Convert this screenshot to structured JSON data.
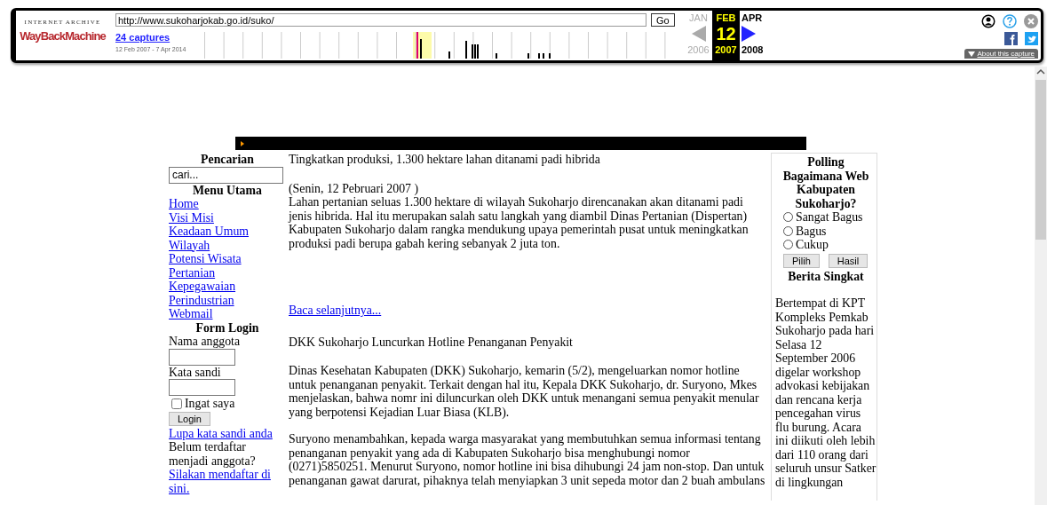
{
  "toolbar": {
    "logo_top": "INTERNET ARCHIVE",
    "logo_main": "WayBackMachine",
    "url": "http://www.sukoharjokab.go.id/suko/",
    "go": "Go",
    "captures": "24 captures",
    "range": "12 Feb 2007 - 7 Apr 2014",
    "calendar": [
      {
        "month": "JAN",
        "year": "2006",
        "disabled": true,
        "selected": false
      },
      {
        "month": "FEB",
        "day": "12",
        "year": "2007",
        "disabled": false,
        "selected": true
      },
      {
        "month": "APR",
        "year": "2008",
        "disabled": false,
        "selected": false
      }
    ],
    "about": "About this capture"
  },
  "sidebar": {
    "search_title": "Pencarian",
    "search_value": "cari...",
    "menu_title": "Menu Utama",
    "menu": [
      "Home",
      "Visi Misi",
      "Keadaan Umum",
      "Wilayah",
      "Potensi Wisata",
      "Pertanian",
      "Kepegawaian",
      "Perindustrian",
      "Webmail"
    ],
    "login_title": "Form Login",
    "username_label": "Nama anggota",
    "password_label": "Kata sandi",
    "remember": {
      "label": "Ingat saya",
      "checked": false
    },
    "login_button": "Login",
    "forgot": "Lupa kata sandi anda",
    "register_text": "Belum terdaftar menjadi anggota?",
    "register_link": "Silakan mendaftar di sini."
  },
  "articles": [
    {
      "title": "Tingkatkan produksi, 1.300 hektare lahan ditanami padi hibrida",
      "date": "(Senin, 12 Pebruari 2007 )",
      "paragraphs": [
        "Lahan pertanian seluas 1.300 hektare di wilayah Sukoharjo direncanakan akan ditanami padi jenis hibrida. Hal itu merupakan salah satu langkah yang diambil Dinas Pertanian (Dispertan) Kabupaten Sukoharjo dalam rangka mendukung upaya pemerintah pusat untuk meningkatkan produksi padi berupa gabah kering sebanyak 2 juta ton."
      ],
      "more": "Baca selanjutnya..."
    },
    {
      "title": "DKK Sukoharjo Luncurkan Hotline Penanganan Penyakit",
      "paragraphs": [
        "Dinas Kesehatan Kabupaten (DKK) Sukoharjo, kemarin (5/2), mengeluarkan nomor hotline untuk penanganan penyakit. Terkait dengan hal itu, Kepala DKK Sukoharjo, dr. Suryono, Mkes menjelaskan, bahwa nomr ini diluncurkan oleh DKK untuk menangani semua penyakit menular yang berpotensi Kejadian Luar Biasa (KLB).",
        "Suryono menambahkan, kepada warga masyarakat yang membutuhkan semua informasi tentang penanganan penyakit yang ada di Kabupaten Sukoharjo bisa menghubungi nomor (0271)5850251. Menurut Suryono, nomor hotline ini bisa dihubungi 24 jam non-stop. Dan untuk penanganan gawat darurat, pihaknya telah menyiapkan 3 unit sepeda motor dan 2 buah ambulans"
      ]
    }
  ],
  "poll": {
    "title": "Polling",
    "question": "Bagaimana Web Kabupaten Sukoharjo?",
    "options": [
      {
        "label": "Sangat Bagus",
        "selected": false
      },
      {
        "label": "Bagus",
        "selected": false
      },
      {
        "label": "Cukup",
        "selected": false
      }
    ],
    "buttons": [
      "Pilih",
      "Hasil"
    ]
  },
  "news": {
    "title": "Berita Singkat",
    "text": "Bertempat di KPT Kompleks Pemkab Sukoharjo pada hari Selasa 12 September 2006 digelar workshop advokasi kebijakan dan rencana kerja pencegahan virus flu burung. Acara ini diikuti oleh lebih dari 110 orang dari seluruh unsur Satker di lingkungan"
  }
}
